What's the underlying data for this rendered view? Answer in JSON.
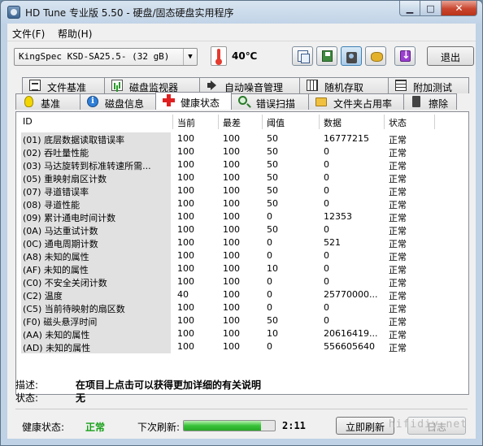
{
  "window": {
    "title": "HD Tune 专业版 5.50 - 硬盘/固态硬盘实用程序"
  },
  "menu": {
    "file": "文件(F)",
    "help": "帮助(H)"
  },
  "toolbar": {
    "drive": "KingSpec KSD-SA25.5- (32 gB)",
    "temperature": "40℃",
    "exit_label": "退出"
  },
  "tabs_row1": [
    {
      "label": "文件基准",
      "icon": "document-icon"
    },
    {
      "label": "磁盘监视器",
      "icon": "chart-icon"
    },
    {
      "label": "自动噪音管理",
      "icon": "speaker-icon"
    },
    {
      "label": "随机存取",
      "icon": "grid-icon"
    },
    {
      "label": "附加测试",
      "icon": "table-icon"
    }
  ],
  "tabs_row2": [
    {
      "label": "基准",
      "icon": "bulb-icon"
    },
    {
      "label": "磁盘信息",
      "icon": "info-icon"
    },
    {
      "label": "健康状态",
      "icon": "health-cross-icon"
    },
    {
      "label": "错误扫描",
      "icon": "search-icon"
    },
    {
      "label": "文件夹占用率",
      "icon": "folder-icon"
    },
    {
      "label": "擦除",
      "icon": "trash-icon"
    }
  ],
  "table": {
    "columns": {
      "id": "ID",
      "current": "当前",
      "worst": "最差",
      "threshold": "阈值",
      "data": "数据",
      "status": "状态"
    },
    "rows": [
      {
        "id": "(01) 底层数据读取错误率",
        "current": "100",
        "worst": "100",
        "threshold": "50",
        "data": "16777215",
        "status": "正常"
      },
      {
        "id": "(02) 吞吐量性能",
        "current": "100",
        "worst": "100",
        "threshold": "50",
        "data": "0",
        "status": "正常"
      },
      {
        "id": "(03) 马达旋转到标准转速所需...",
        "current": "100",
        "worst": "100",
        "threshold": "50",
        "data": "0",
        "status": "正常"
      },
      {
        "id": "(05) 重映射扇区计数",
        "current": "100",
        "worst": "100",
        "threshold": "50",
        "data": "0",
        "status": "正常"
      },
      {
        "id": "(07) 寻道错误率",
        "current": "100",
        "worst": "100",
        "threshold": "50",
        "data": "0",
        "status": "正常"
      },
      {
        "id": "(08) 寻道性能",
        "current": "100",
        "worst": "100",
        "threshold": "50",
        "data": "0",
        "status": "正常"
      },
      {
        "id": "(09) 累计通电时间计数",
        "current": "100",
        "worst": "100",
        "threshold": "0",
        "data": "12353",
        "status": "正常"
      },
      {
        "id": "(0A) 马达重试计数",
        "current": "100",
        "worst": "100",
        "threshold": "50",
        "data": "0",
        "status": "正常"
      },
      {
        "id": "(0C) 通电周期计数",
        "current": "100",
        "worst": "100",
        "threshold": "0",
        "data": "521",
        "status": "正常"
      },
      {
        "id": "(A8) 未知的属性",
        "current": "100",
        "worst": "100",
        "threshold": "0",
        "data": "0",
        "status": "正常"
      },
      {
        "id": "(AF) 未知的属性",
        "current": "100",
        "worst": "100",
        "threshold": "10",
        "data": "0",
        "status": "正常"
      },
      {
        "id": "(C0) 不安全关闭计数",
        "current": "100",
        "worst": "100",
        "threshold": "0",
        "data": "0",
        "status": "正常"
      },
      {
        "id": "(C2) 温度",
        "current": "40",
        "worst": "100",
        "threshold": "0",
        "data": "25770000...",
        "status": "正常"
      },
      {
        "id": "(C5) 当前待映射的扇区数",
        "current": "100",
        "worst": "100",
        "threshold": "0",
        "data": "0",
        "status": "正常"
      },
      {
        "id": "(F0) 磁头悬浮时间",
        "current": "100",
        "worst": "100",
        "threshold": "50",
        "data": "0",
        "status": "正常"
      },
      {
        "id": "(AA) 未知的属性",
        "current": "100",
        "worst": "100",
        "threshold": "10",
        "data": "20616419...",
        "status": "正常"
      },
      {
        "id": "(AD) 未知的属性",
        "current": "100",
        "worst": "100",
        "threshold": "0",
        "data": "556605640",
        "status": "正常"
      }
    ]
  },
  "description": {
    "desc_label": "描述:",
    "desc_value": "在项目上点击可以获得更加详细的有关说明",
    "state_label": "状态:",
    "state_value": "无"
  },
  "status": {
    "health_label": "健康状态:",
    "health_value": "正常",
    "refresh_label": "下次刷新:",
    "refresh_progress": 0.85,
    "countdown": "2:11",
    "refresh_button": "立即刷新",
    "log_button": "日志"
  },
  "watermark": "hifidiy.net",
  "colors": {
    "health_ok": "#18a018",
    "progress": "#38c238",
    "close_button": "#c9452e"
  }
}
